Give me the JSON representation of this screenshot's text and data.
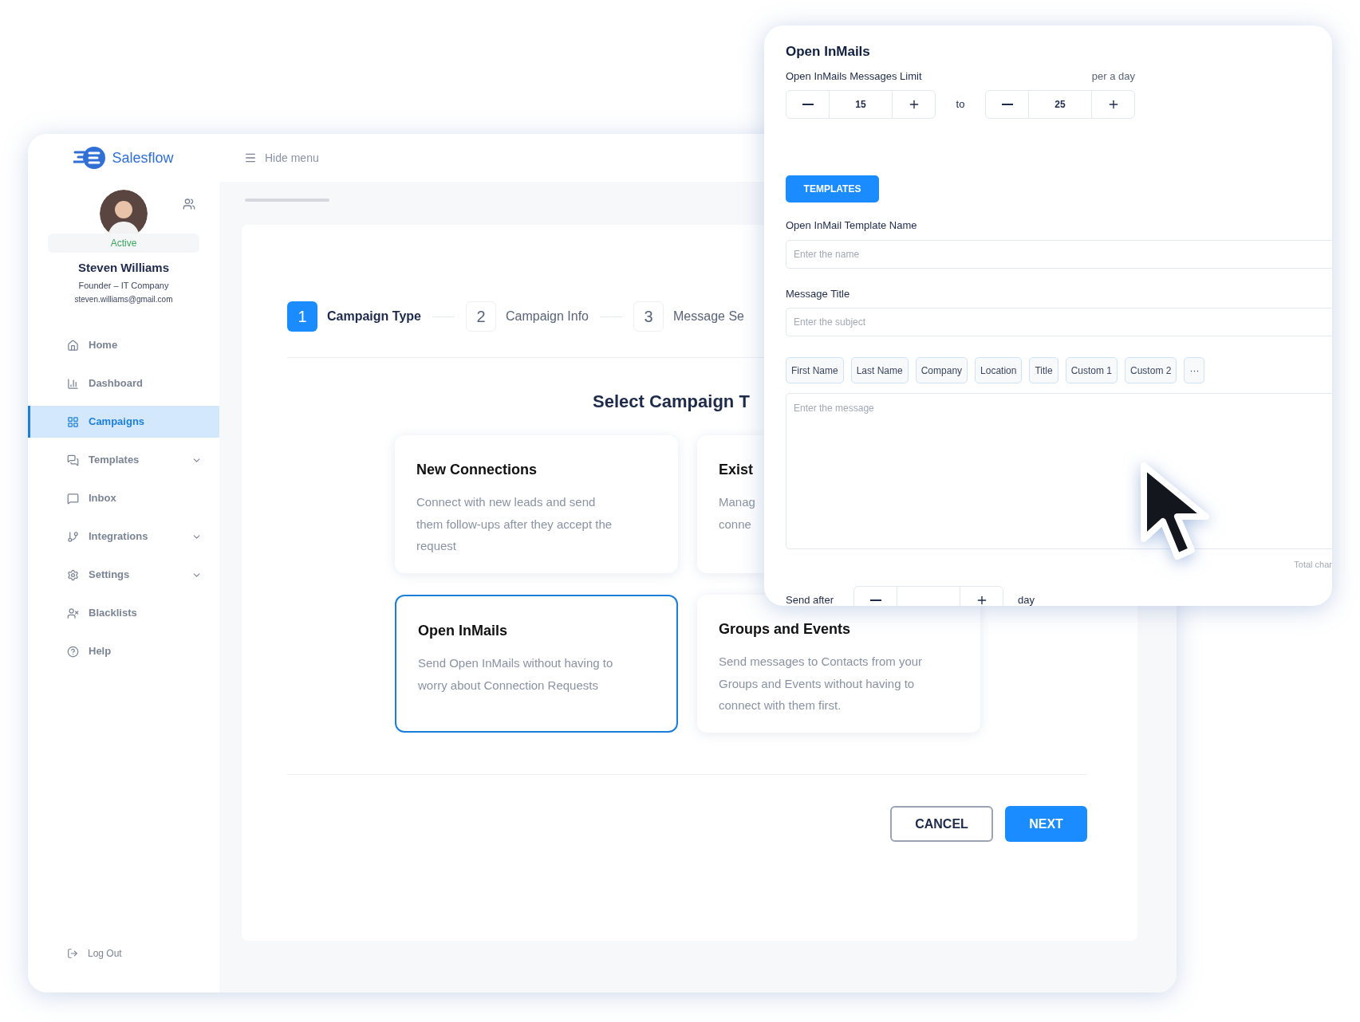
{
  "brand": {
    "name": "Salesflow"
  },
  "profile": {
    "status": "Active",
    "name": "Steven Williams",
    "role": "Founder – IT Company",
    "email": "steven.williams@gmail.com"
  },
  "nav": [
    {
      "label": "Home",
      "selected": false,
      "expandable": false
    },
    {
      "label": "Dashboard",
      "selected": false,
      "expandable": false
    },
    {
      "label": "Campaigns",
      "selected": true,
      "expandable": false
    },
    {
      "label": "Templates",
      "selected": false,
      "expandable": true
    },
    {
      "label": "Inbox",
      "selected": false,
      "expandable": false
    },
    {
      "label": "Integrations",
      "selected": false,
      "expandable": true
    },
    {
      "label": "Settings",
      "selected": false,
      "expandable": true
    },
    {
      "label": "Blacklists",
      "selected": false,
      "expandable": false
    },
    {
      "label": "Help",
      "selected": false,
      "expandable": false
    }
  ],
  "logout": "Log Out",
  "header": {
    "toggle": "Hide menu"
  },
  "steps": [
    {
      "number": "1",
      "label": "Campaign Type",
      "selected": true
    },
    {
      "number": "2",
      "label": "Campaign Info",
      "selected": false
    },
    {
      "number": "3",
      "label": "Message Se",
      "selected": false
    }
  ],
  "heading": "Select Campaign T",
  "campaign_types": [
    {
      "title": "New Connections",
      "description_lines": [
        "Connect with new leads and send",
        "them follow-ups after they accept the",
        "request"
      ],
      "selected": false
    },
    {
      "title": "Exist",
      "description_lines": [
        "Manag",
        "conne"
      ],
      "selected": false
    },
    {
      "title": "Open InMails",
      "description_lines": [
        "Send Open InMails without having to",
        "worry about Connection Requests"
      ],
      "selected": true
    },
    {
      "title": "Groups and Events",
      "description_lines": [
        "Send messages to Contacts from your",
        "Groups and Events without having to",
        "connect with them first."
      ],
      "selected": false
    }
  ],
  "actions": [
    {
      "label": "CANCEL",
      "kind": "secondary"
    },
    {
      "label": "NEXT",
      "kind": "primary"
    }
  ],
  "panel": {
    "title": "Open InMails",
    "limit_label": "Open InMails Messages Limit",
    "limit_unit": "per a day",
    "limit_from": "15",
    "limit_separator": "to",
    "limit_to": "25",
    "templates_button": "TEMPLATES",
    "name_label": "Open InMail Template Name",
    "name_placeholder": "Enter the name",
    "subject_label": "Message Title",
    "subject_placeholder": "Enter the subject",
    "variables": [
      "First Name",
      "Last Name",
      "Company",
      "Location",
      "Title",
      "Custom 1",
      "Custom 2",
      "···"
    ],
    "message_placeholder": "Enter the message",
    "counter": "Total char",
    "send_after_label": "Send after",
    "send_after_unit": "day"
  }
}
